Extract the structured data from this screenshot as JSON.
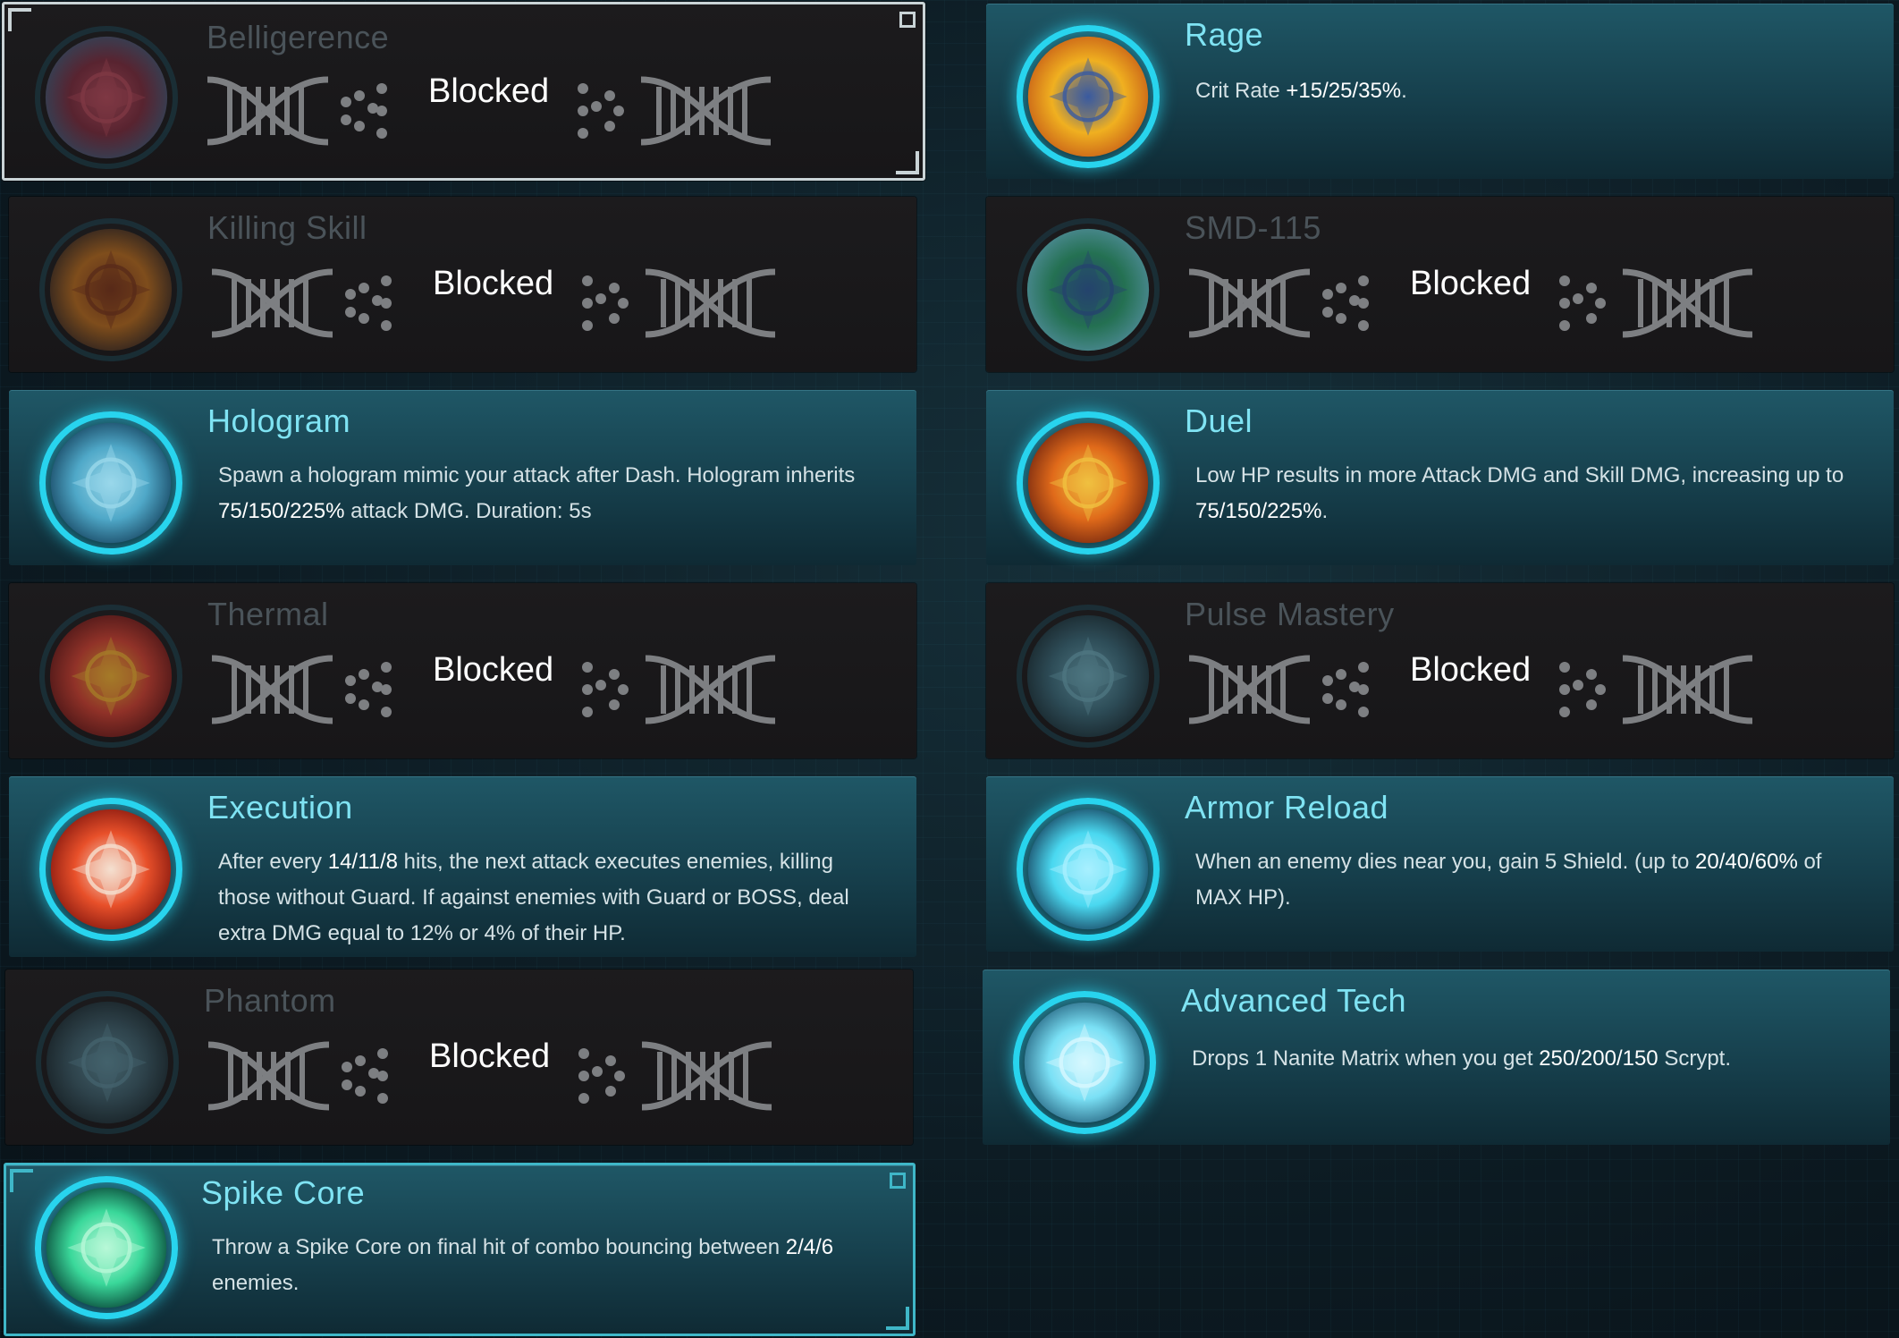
{
  "cards": [
    {
      "title": "Belligerence",
      "state": "blocked",
      "blocked_label": "Blocked",
      "icon": "belligerence-icon",
      "palette": [
        "#7a2a3c",
        "#b54a5a",
        "#3f5a78"
      ]
    },
    {
      "title": "Rage",
      "state": "active",
      "desc_parts": [
        "Crit Rate ",
        "+15/25/35%",
        "."
      ],
      "icon": "rage-icon",
      "palette": [
        "#f0b020",
        "#3a5aa0",
        "#c86018"
      ]
    },
    {
      "title": "Killing Skill",
      "state": "blocked",
      "blocked_label": "Blocked",
      "icon": "killing-skill-icon",
      "palette": [
        "#b56a1e",
        "#7a3418",
        "#3a2a22"
      ]
    },
    {
      "title": "SMD-115",
      "state": "blocked",
      "blocked_label": "Blocked",
      "icon": "smd-115-icon",
      "palette": [
        "#2aa070",
        "#2a5a9a",
        "#6ac8d8"
      ]
    },
    {
      "title": "Hologram",
      "state": "active",
      "desc_parts": [
        "Spawn a hologram mimic your attack after Dash. Hologram inherits ",
        "75/150/225%",
        " attack DMG. Duration: 5s"
      ],
      "icon": "hologram-icon",
      "palette": [
        "#4fa8c8",
        "#9ad8ea",
        "#1a4a66"
      ]
    },
    {
      "title": "Duel",
      "state": "active",
      "desc_parts": [
        "Low HP results in more Attack DMG and Skill DMG, increasing up to ",
        "75/150/225%",
        "."
      ],
      "icon": "duel-icon",
      "palette": [
        "#e06a1a",
        "#f0c040",
        "#7a2a10"
      ]
    },
    {
      "title": "Thermal",
      "state": "blocked",
      "blocked_label": "Blocked",
      "icon": "thermal-icon",
      "palette": [
        "#d04030",
        "#f0b030",
        "#6a1818"
      ]
    },
    {
      "title": "Pulse Mastery",
      "state": "blocked",
      "blocked_label": "Blocked",
      "icon": "pulse-mastery-icon",
      "palette": [
        "#3a6a7a",
        "#6aa8b8",
        "#1a3038"
      ]
    },
    {
      "title": "Execution",
      "state": "active",
      "desc_parts": [
        "After every ",
        "14/11/8",
        " hits, the next attack executes enemies, killing those without Guard. If against enemies with Guard or BOSS, deal extra DMG equal to 12% or 4% of their HP."
      ],
      "icon": "execution-icon",
      "palette": [
        "#e8502a",
        "#f5e0d0",
        "#8a1a10"
      ]
    },
    {
      "title": "Armor Reload",
      "state": "active",
      "desc_parts": [
        "When an enemy dies near you, gain 5 Shield. (up to ",
        "20/40/60%",
        " of MAX HP)."
      ],
      "icon": "armor-reload-icon",
      "palette": [
        "#4ad8f0",
        "#a8f0ff",
        "#1a4a66"
      ]
    },
    {
      "title": "Phantom",
      "state": "blocked",
      "blocked_label": "Blocked",
      "icon": "phantom-icon",
      "palette": [
        "#3a5a66",
        "#5a8a98",
        "#1a2a30"
      ]
    },
    {
      "title": "Advanced Tech",
      "state": "active",
      "desc_parts": [
        "Drops 1 Nanite Matrix when you get ",
        "250/200/150",
        " Scrypt."
      ],
      "icon": "advanced-tech-icon",
      "palette": [
        "#7ae0f5",
        "#d8f8ff",
        "#2a6a86"
      ]
    },
    {
      "title": "Spike Core",
      "state": "active",
      "desc_parts": [
        "Throw a Spike Core on final hit of combo bouncing between ",
        "2/4/6",
        " enemies."
      ],
      "icon": "spike-core-icon",
      "palette": [
        "#3ad89a",
        "#b8f8d8",
        "#0a4a3a"
      ]
    }
  ]
}
